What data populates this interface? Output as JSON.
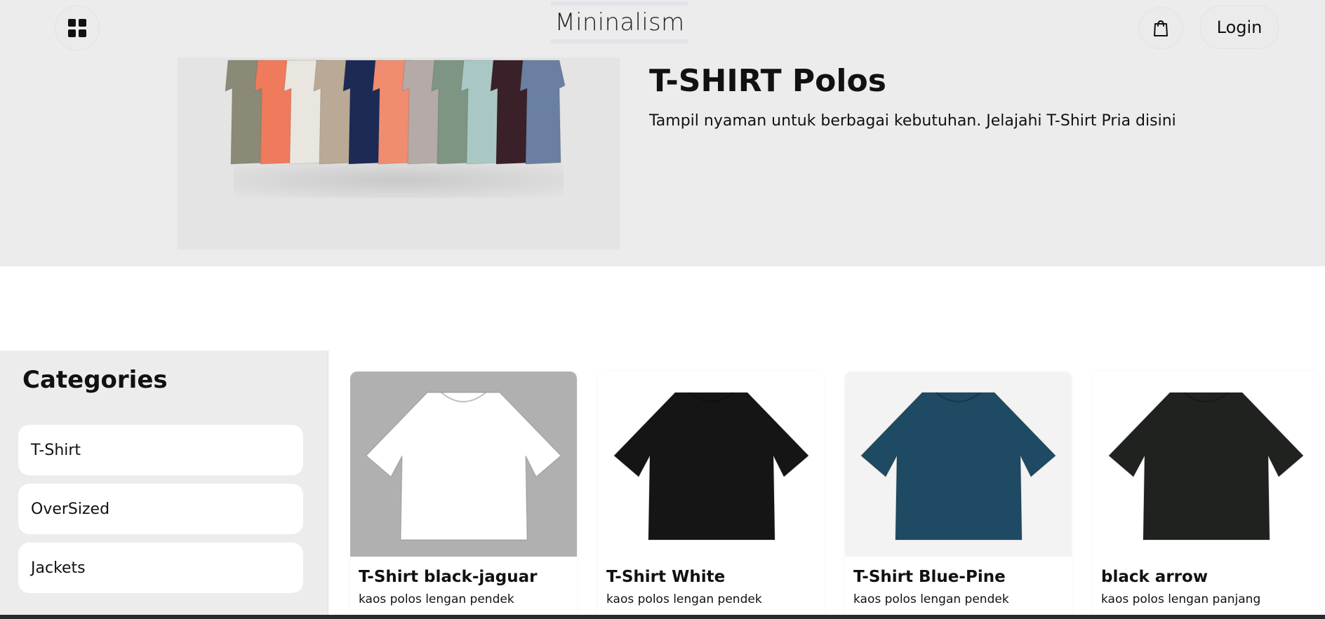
{
  "header": {
    "brand": "Mininalism",
    "login_label": "Login",
    "menu_icon": "grid-icon",
    "cart_icon": "shopping-bag-icon"
  },
  "hero": {
    "title": "T-SHIRT Polos",
    "subtitle": "Tampil nyaman untuk berbagai kebutuhan. Jelajahi T-Shirt Pria disini",
    "shirt_colors": [
      "#8a8a76",
      "#ef7a5c",
      "#e9e6e0",
      "#b9a995",
      "#1d2a55",
      "#f08c6f",
      "#b4aaa7",
      "#7e9583",
      "#a9c8c5",
      "#3a2028",
      "#6a7fa2"
    ]
  },
  "categories": {
    "heading": "Categories",
    "items": [
      {
        "label": "T-Shirt"
      },
      {
        "label": "OverSized"
      },
      {
        "label": "Jackets"
      }
    ]
  },
  "products": [
    {
      "name": "T-Shirt black-jaguar",
      "desc": "kaos polos lengan pendek",
      "bg": "#b0b0b0",
      "color": "#ffffff"
    },
    {
      "name": "T-Shirt White",
      "desc": "kaos polos lengan pendek",
      "bg": "#ffffff",
      "color": "#151515"
    },
    {
      "name": "T-Shirt Blue-Pine",
      "desc": "kaos polos lengan pendek",
      "bg": "#f3f3f3",
      "color": "#1e4a63"
    },
    {
      "name": "black arrow",
      "desc": "kaos polos lengan panjang",
      "bg": "#ffffff",
      "color": "#1f221f"
    }
  ]
}
